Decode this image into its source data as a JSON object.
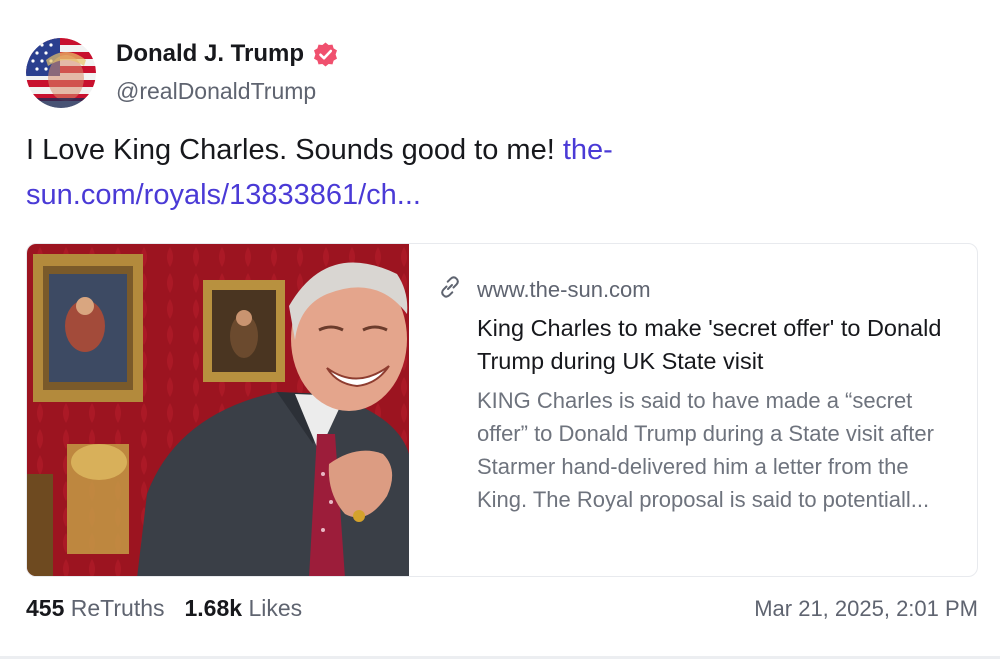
{
  "author": {
    "display_name": "Donald J. Trump",
    "handle": "@realDonaldTrump",
    "verified_icon": "verified-badge-icon",
    "badge_color": "#f0506e"
  },
  "post": {
    "text": "I Love King Charles. Sounds good to me! ",
    "link_text": "the-sun.com/royals/13833861/ch...",
    "link_color": "#4a3ad6"
  },
  "link_card": {
    "link_icon": "link-icon",
    "domain": "www.the-sun.com",
    "title": "King Charles to make 'secret offer' to Donald Trump during UK State visit",
    "description": "KING Charles is said to have made a “secret offer” to Donald Trump during a State visit after Starmer hand-delivered him a letter from the King. The Royal proposal is said to potentiall..."
  },
  "stats": {
    "retruths_count": "455",
    "retruths_label": "ReTruths",
    "likes_count": "1.68k",
    "likes_label": "Likes"
  },
  "timestamp": "Mar 21, 2025, 2:01 PM"
}
